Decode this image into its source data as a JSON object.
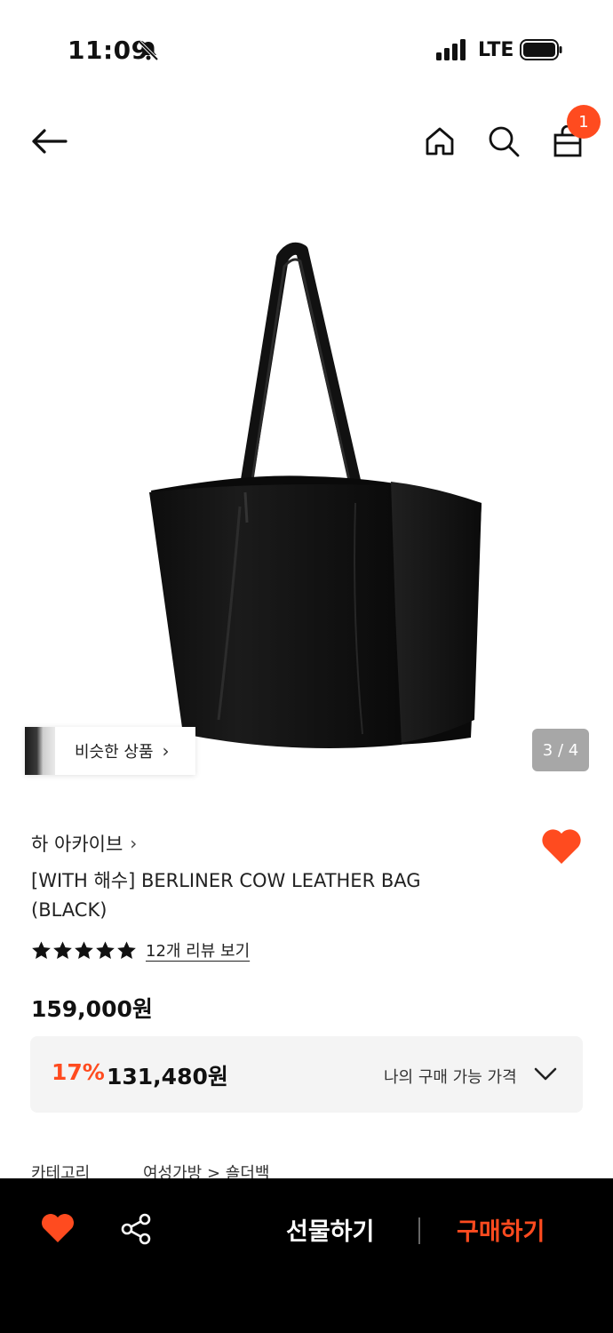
{
  "status_bar": {
    "time": "11:09",
    "network": "LTE"
  },
  "nav": {
    "cart_count": "1"
  },
  "gallery": {
    "similar_label": "비슷한 상품",
    "page_indicator": "3 / 4"
  },
  "product": {
    "brand": "하 아카이브",
    "title": "[WITH 해수] BERLINER COW LEATHER BAG (BLACK)",
    "rating_stars": 5,
    "review_link": "12개 리뷰 보기",
    "price": "159,000원",
    "discount_rate": "17%",
    "discount_price": "131,480원",
    "my_price_label": "나의 구매 가능 가격",
    "category_label": "카테고리",
    "category_path": "여성가방 > 숄더백"
  },
  "bottom_bar": {
    "gift_label": "선물하기",
    "buy_label": "구매하기"
  },
  "colors": {
    "accent": "#ff4b1f",
    "bar_bg": "#000000",
    "discount_box_bg": "#f4f4f4"
  },
  "icons": [
    "back-arrow-icon",
    "home-icon",
    "search-icon",
    "shopping-bag-icon",
    "heart-icon",
    "share-icon",
    "chevron-down-icon",
    "star-icon",
    "bell-off-icon",
    "signal-icon",
    "battery-icon"
  ]
}
